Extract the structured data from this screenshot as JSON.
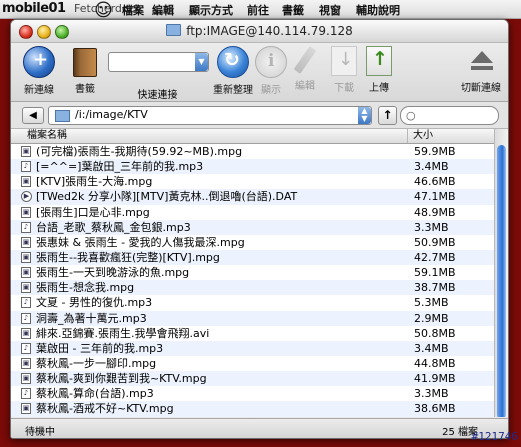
{
  "menubar": {
    "logo": "mobile01",
    "items": [
      "Fetcherdock",
      "檔案",
      "編輯",
      "顯示方式",
      "前往",
      "書籤",
      "視窗",
      "輔助說明"
    ]
  },
  "window": {
    "title": "ftp:IMAGE@140.114.79.128"
  },
  "toolbar": {
    "new_connection": "新連線",
    "bookmarks": "書籤",
    "quick_connect": "快速連接",
    "quick_connect_value": "",
    "refresh": "重新整理",
    "info": "顯示",
    "edit": "編輯",
    "download": "下載",
    "upload": "上傳",
    "disconnect": "切斷連線"
  },
  "pathbar": {
    "path": "/i:/image/KTV",
    "search_placeholder": ""
  },
  "list": {
    "col_name": "檔案名稱",
    "col_size": "大小",
    "rows": [
      {
        "name": "(可完檔)張雨生-我期待(59.92~MB).mpg",
        "size": "59.9MB",
        "icon": "video"
      },
      {
        "name": "[=^^=]葉啟田_三年前的我.mp3",
        "size": "3.4MB",
        "icon": "audio"
      },
      {
        "name": "[KTV]張雨生-大海.mpg",
        "size": "46.6MB",
        "icon": "video"
      },
      {
        "name": "[TWed2k 分享小隊][MTV]黃克林..倒退嚕(台語).DAT",
        "size": "47.1MB",
        "icon": "play"
      },
      {
        "name": "[張雨生]口是心非.mpg",
        "size": "48.9MB",
        "icon": "video"
      },
      {
        "name": "台語_老歌_蔡秋鳳_金包銀.mp3",
        "size": "3.3MB",
        "icon": "audio"
      },
      {
        "name": "張惠妹 & 張雨生 - 愛我的人傷我最深.mpg",
        "size": "50.9MB",
        "icon": "video"
      },
      {
        "name": "張雨生--我喜歡瘋狂(完整)[KTV].mpg",
        "size": "42.7MB",
        "icon": "video"
      },
      {
        "name": "張雨生-一天到晚游泳的魚.mpg",
        "size": "59.1MB",
        "icon": "video"
      },
      {
        "name": "張雨生-想念我.mpg",
        "size": "38.7MB",
        "icon": "video"
      },
      {
        "name": "文夏 - 男性的復仇.mp3",
        "size": "5.3MB",
        "icon": "audio"
      },
      {
        "name": "洞壽_為著十萬元.mp3",
        "size": "2.9MB",
        "icon": "audio"
      },
      {
        "name": "緋來.亞錦賽.張雨生.我學會飛翔.avi",
        "size": "50.8MB",
        "icon": "video"
      },
      {
        "name": "葉啟田 - 三年前的我.mp3",
        "size": "3.4MB",
        "icon": "audio"
      },
      {
        "name": "蔡秋鳳-一步一腳印.mpg",
        "size": "44.8MB",
        "icon": "video"
      },
      {
        "name": "蔡秋鳳-爽到你艱苦到我~KTV.mpg",
        "size": "41.9MB",
        "icon": "video"
      },
      {
        "name": "蔡秋鳳-算命(台語).mp3",
        "size": "3.3MB",
        "icon": "audio"
      },
      {
        "name": "蔡秋鳳-酒戒不好~KTV.mpg",
        "size": "38.6MB",
        "icon": "video"
      },
      {
        "name": "蔡秋鳳-醉歸晚~KTV.mpg",
        "size": "40.6MB",
        "icon": "video"
      },
      {
        "name": "蔡秋鳳_金包銀.mpg",
        "size": "35.3MB",
        "icon": "video"
      }
    ]
  },
  "status": {
    "left": "待機中",
    "right": "25 檔案"
  },
  "watermark": "#121746"
}
